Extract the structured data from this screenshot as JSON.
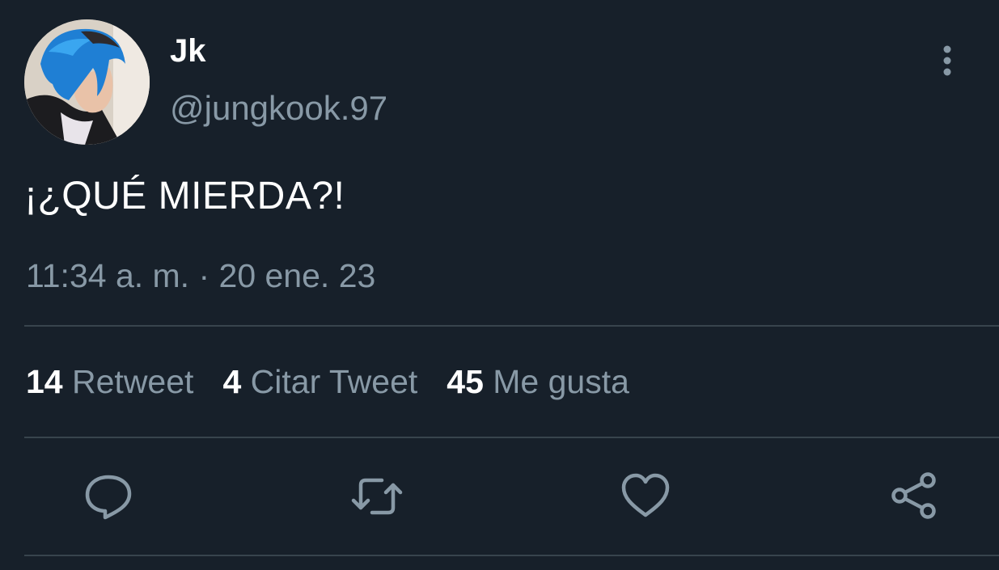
{
  "colors": {
    "background": "#17202a",
    "primary_text": "#ffffff",
    "secondary_text": "#8899a6",
    "divider": "#38444d"
  },
  "author": {
    "name": "Jk",
    "handle": "@jungkook.97"
  },
  "tweet": {
    "text": "¡¿QUÉ MIERDA?!",
    "timestamp": "11:34 a. m. · 20 ene. 23"
  },
  "stats": {
    "retweets": {
      "count": "14",
      "label": "Retweet"
    },
    "quotes": {
      "count": "4",
      "label": "Citar Tweet"
    },
    "likes": {
      "count": "45",
      "label": "Me gusta"
    }
  },
  "actions": {
    "reply_icon": "reply-icon",
    "retweet_icon": "retweet-icon",
    "like_icon": "heart-icon",
    "share_icon": "share-icon"
  },
  "menu_icon": "more-vertical-icon"
}
